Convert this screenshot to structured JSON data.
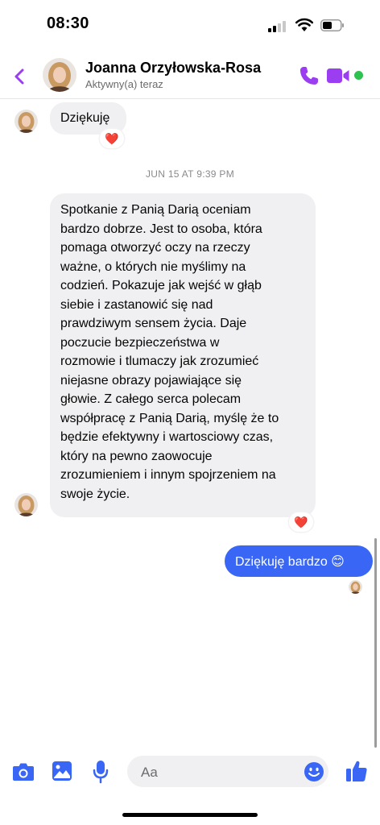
{
  "status_bar": {
    "time": "08:30"
  },
  "header": {
    "contact_name": "Joanna Orzyłowska-Rosa",
    "status": "Aktywny(a) teraz"
  },
  "colors": {
    "accent": "#9b3df0",
    "bubble_out": "#3a66f5",
    "bubble_in": "#f0f0f2",
    "online": "#2ec34e"
  },
  "conversation": {
    "messages": [
      {
        "direction": "incoming",
        "text": "Dziękuję",
        "reaction": "❤️"
      },
      {
        "type": "timestamp",
        "text": "JUN 15 AT 9:39 PM"
      },
      {
        "direction": "incoming",
        "lines": [
          "Spotkanie z Panią Darią oceniam",
          "bardzo dobrze. Jest to osoba, która",
          "pomaga otworzyć oczy na rzeczy",
          "ważne, o których nie myślimy na",
          "codzień. Pokazuje jak wejść w głąb",
          "siebie i zastanowić się nad",
          "prawdziwym sensem życia. Daje",
          "poczucie bezpieczeństwa w",
          "rozmowie i tlumaczy jak zrozumieć",
          "niejasne obrazy pojawiające się",
          "głowie. Z całego serca polecam",
          "współpracę z Panią Darią, myślę że to",
          "będzie efektywny i wartosciowy czas,",
          "który na pewno zaowocuje",
          "zrozumieniem i innym spojrzeniem na",
          "swoje życie."
        ],
        "reaction": "❤️"
      },
      {
        "direction": "outgoing",
        "text": "Dziękuję bardzo 😊",
        "seen": true
      }
    ]
  },
  "composer": {
    "placeholder": "Aa",
    "icons": [
      "camera-icon",
      "gallery-icon",
      "microphone-icon",
      "emoji-icon",
      "thumbs-up-icon"
    ]
  }
}
